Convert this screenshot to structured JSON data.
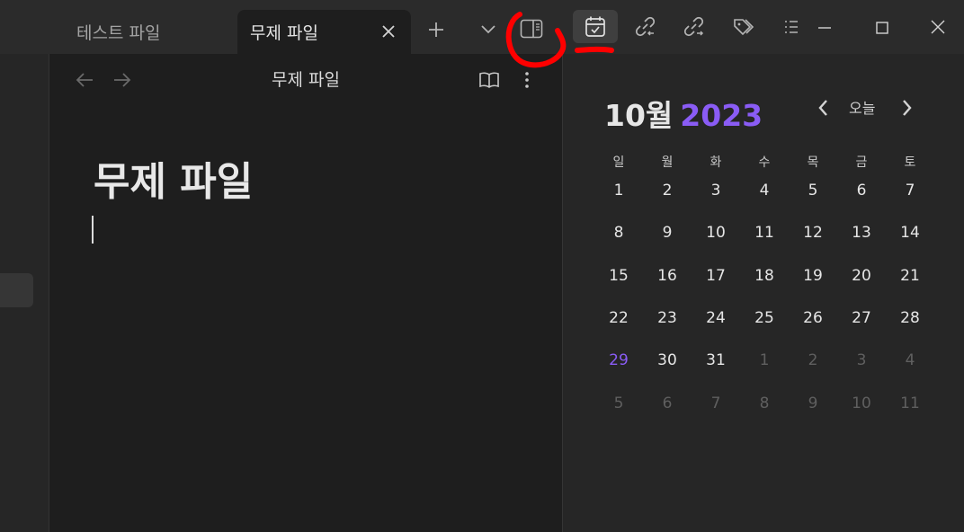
{
  "tabs": [
    {
      "label": "테스트 파일",
      "active": false
    },
    {
      "label": "무제 파일",
      "active": true
    }
  ],
  "editor": {
    "header_title": "무제 파일",
    "doc_title": "무제 파일"
  },
  "calendar": {
    "month_label": "10월",
    "year_label": "2023",
    "today_label": "오늘",
    "weekdays": [
      "일",
      "월",
      "화",
      "수",
      "목",
      "금",
      "토"
    ],
    "weeks": [
      [
        "1",
        "2",
        "3",
        "4",
        "5",
        "6",
        "7"
      ],
      [
        "8",
        "9",
        "10",
        "11",
        "12",
        "13",
        "14"
      ],
      [
        "15",
        "16",
        "17",
        "18",
        "19",
        "20",
        "21"
      ],
      [
        "22",
        "23",
        "24",
        "25",
        "26",
        "27",
        "28"
      ],
      [
        "29",
        "30",
        "31",
        "1",
        "2",
        "3",
        "4"
      ],
      [
        "5",
        "6",
        "7",
        "8",
        "9",
        "10",
        "11"
      ]
    ],
    "today_day": "29",
    "accent_color": "#8a5cf5"
  },
  "colors": {
    "annotation": "#ff0000",
    "background": "#1e1e1e",
    "panel": "#262626",
    "topbar": "#2b2b2b"
  }
}
